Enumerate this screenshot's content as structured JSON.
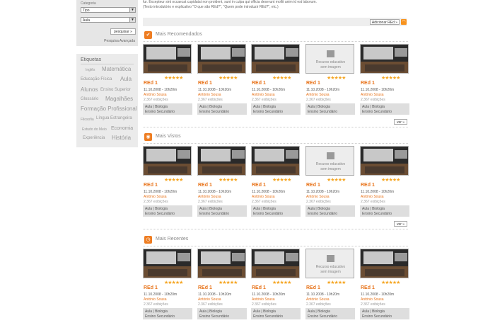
{
  "sidebar": {
    "category_label": "Categoria",
    "select1": "Tipo",
    "select2": "Aula",
    "search_button": "pesquisar »",
    "advanced_search": "Pesquisa Avançada",
    "tags_title": "Etiquetas",
    "tags": [
      {
        "label": "Inglês"
      },
      {
        "label": "Matemática"
      },
      {
        "label": "Educação Física"
      },
      {
        "label": "Aula"
      },
      {
        "label": "Alunos"
      },
      {
        "label": "Ensino Superior"
      },
      {
        "label": "Glossário"
      },
      {
        "label": "Magalhães"
      },
      {
        "label": "Formação Profissional"
      },
      {
        "label": "Filosofia"
      },
      {
        "label": "Língua Estrangeira"
      },
      {
        "label": "Estudo do Meio"
      },
      {
        "label": "Economia"
      },
      {
        "label": "Experiência"
      },
      {
        "label": "História"
      }
    ]
  },
  "intro": {
    "line1": "fur. Excepteur sint occaecat cupidatat non proident, sunt in culpa qui officia deserunt mollit anim id est laborum.",
    "line2": "(Texto introdutório e explicativo \"O que são REd?\", \"Quem pode introduzir REd?\", etc.)"
  },
  "feed": {
    "button": "Adicionar REd »",
    "icon": "rss-icon"
  },
  "sections": [
    {
      "title": "Mais Recomendados",
      "icon": "thumbs-up-icon",
      "icon_glyph": "✔",
      "more": "ver »"
    },
    {
      "title": "Mais Vistos",
      "icon": "eye-icon",
      "icon_glyph": "◉",
      "more": "ver »"
    },
    {
      "title": "Mais Recentes",
      "icon": "clock-icon",
      "icon_glyph": "◷",
      "more": "ver »"
    }
  ],
  "card": {
    "title": "REd 1",
    "date": "11.10.2008 - 10h20m",
    "author": "António Sousa",
    "views": "2.367 exibições",
    "meta1": "Aula  |  Biologia",
    "meta2": "Ensino Secundário",
    "stars": "★★★★★",
    "noimg_line1": "Recurso educativo",
    "noimg_line2": "sem imagem"
  },
  "colors": {
    "accent": "#ee7d22",
    "stars": "#f5a623",
    "link": "#e8731a"
  }
}
